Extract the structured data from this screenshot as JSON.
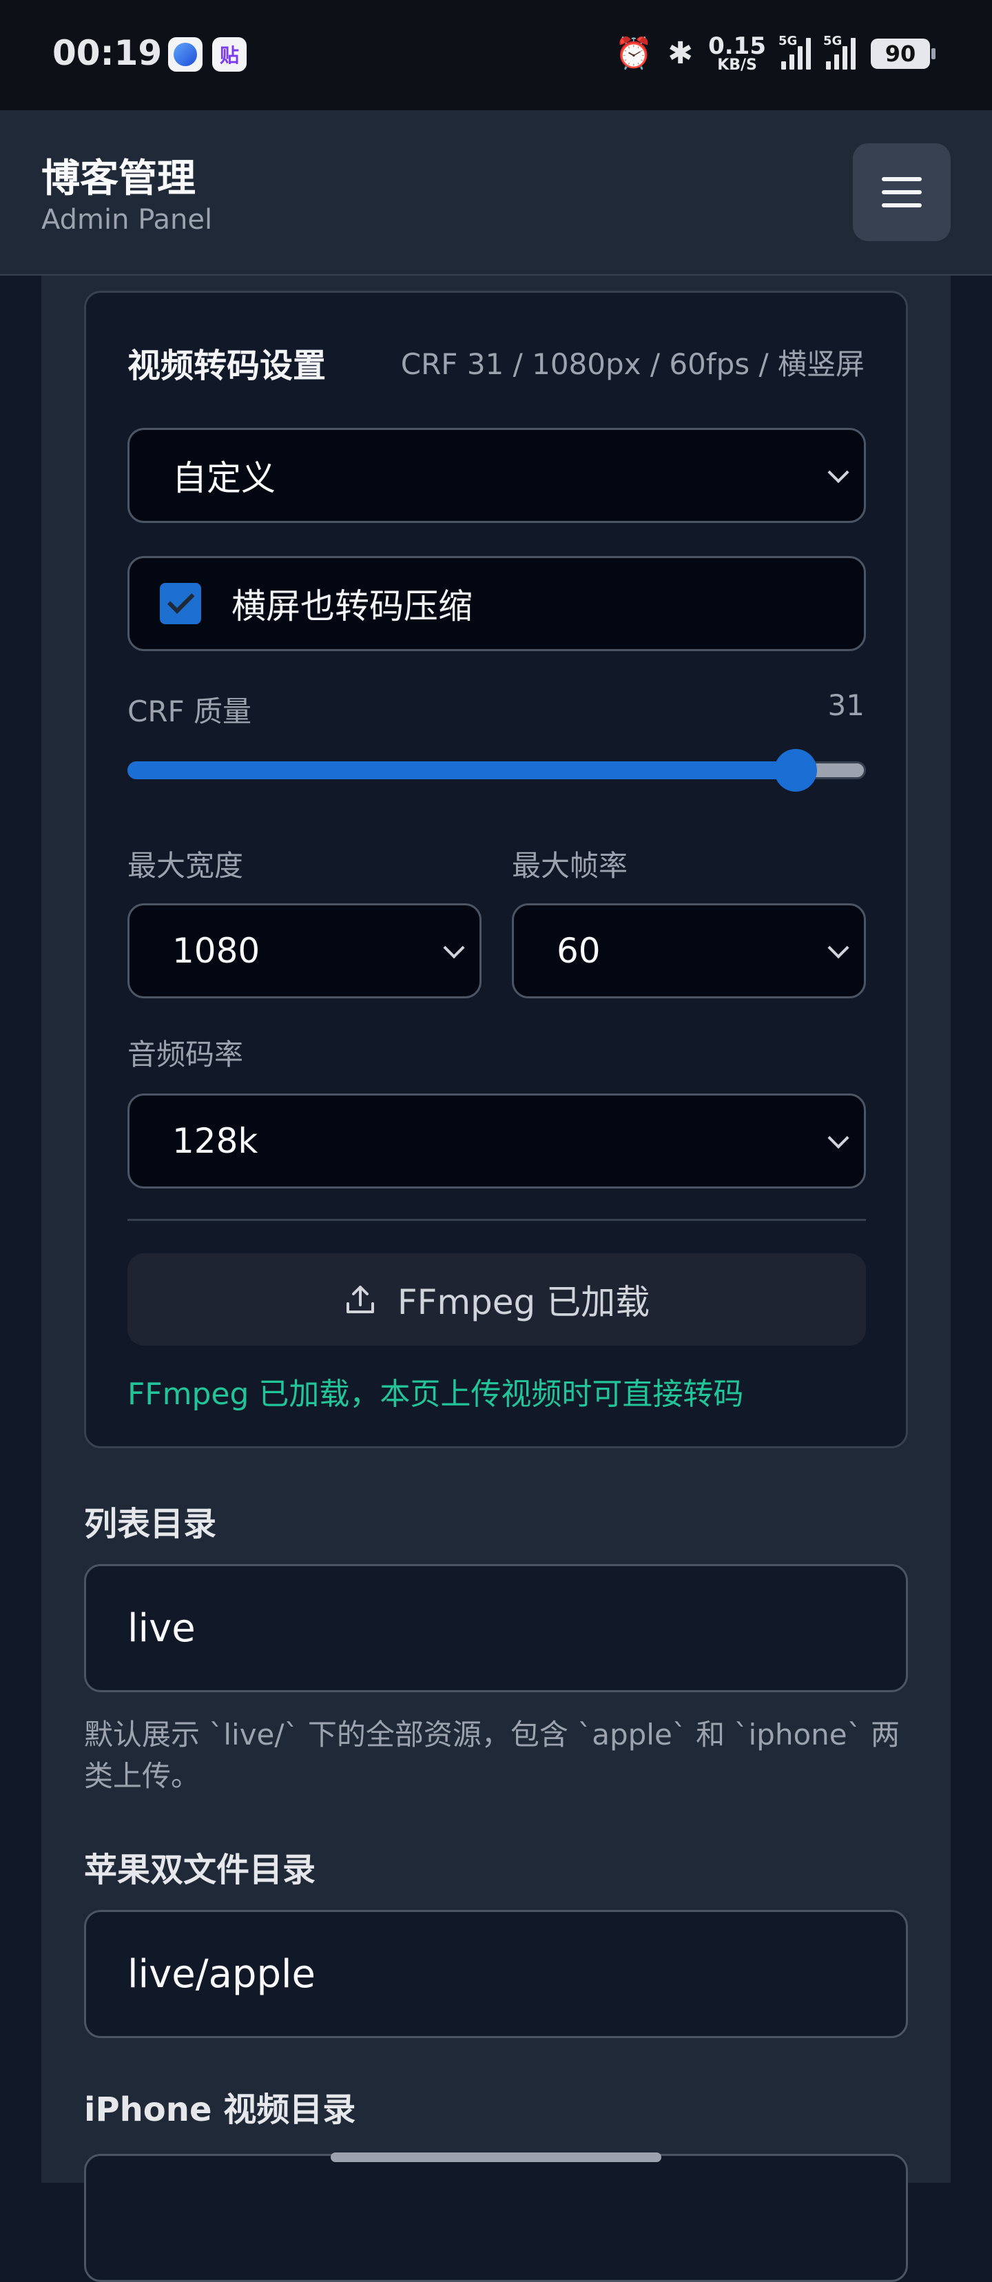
{
  "status_bar": {
    "time": "00:19",
    "badge_2_text": "贴",
    "net_speed_value": "0.15",
    "net_speed_unit": "KB/S",
    "signal_1_label": "5G",
    "signal_2_label": "5G",
    "battery": "90",
    "alarm_icon": "⏰",
    "bluetooth_icon": "✱"
  },
  "header": {
    "title": "博客管理",
    "subtitle": "Admin Panel"
  },
  "transcode": {
    "title": "视频转码设置",
    "summary": "CRF 31 / 1080px / 60fps / 横竖屏",
    "preset": "自定义",
    "landscape_checkbox_label": "横屏也转码压缩",
    "landscape_checked": true,
    "crf_label": "CRF 质量",
    "crf_value": "31",
    "crf_fraction": 0.905,
    "max_width_label": "最大宽度",
    "max_width_value": "1080",
    "max_fps_label": "最大帧率",
    "max_fps_value": "60",
    "audio_bitrate_label": "音频码率",
    "audio_bitrate_value": "128k",
    "ffmpeg_button": "FFmpeg 已加载",
    "ffmpeg_status": "FFmpeg 已加载，本页上传视频时可直接转码"
  },
  "list_dir": {
    "label": "列表目录",
    "value": "live",
    "help": "默认展示 `live/` 下的全部资源，包含 `apple` 和 `iphone` 两类上传。"
  },
  "apple_dir": {
    "label": "苹果双文件目录",
    "value": "live/apple"
  },
  "iphone_dir": {
    "label": "iPhone 视频目录"
  },
  "colors": {
    "accent": "#1b6fd4",
    "success": "#22c59a",
    "background": "#111827",
    "panel": "#1f2937"
  }
}
